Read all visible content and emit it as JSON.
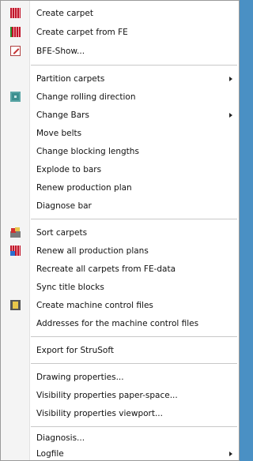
{
  "menu": {
    "items": [
      {
        "label": "Create carpet",
        "icon": "carpet-icon",
        "submenu": false
      },
      {
        "label": "Create carpet from FE",
        "icon": "carpet-fe-icon",
        "submenu": false
      },
      {
        "label": "BFE-Show...",
        "icon": "bfe-show-icon",
        "submenu": false
      },
      {
        "label": "Partition carpets",
        "icon": "",
        "submenu": true
      },
      {
        "label": "Change rolling direction",
        "icon": "rolling-direction-icon",
        "submenu": false
      },
      {
        "label": "Change Bars",
        "icon": "",
        "submenu": true
      },
      {
        "label": "Move belts",
        "icon": "",
        "submenu": false
      },
      {
        "label": "Change blocking lengths",
        "icon": "",
        "submenu": false
      },
      {
        "label": "Explode to bars",
        "icon": "",
        "submenu": false
      },
      {
        "label": "Renew production plan",
        "icon": "",
        "submenu": false
      },
      {
        "label": "Diagnose bar",
        "icon": "",
        "submenu": false
      },
      {
        "label": "Sort carpets",
        "icon": "sort-carpets-icon",
        "submenu": false
      },
      {
        "label": "Renew all production plans",
        "icon": "renew-plans-icon",
        "submenu": false
      },
      {
        "label": "Recreate all carpets from FE-data",
        "icon": "",
        "submenu": false
      },
      {
        "label": "Sync title blocks",
        "icon": "",
        "submenu": false
      },
      {
        "label": "Create machine control files",
        "icon": "machine-control-icon",
        "submenu": false
      },
      {
        "label": "Addresses for the machine control files",
        "icon": "",
        "submenu": false
      },
      {
        "label": "Export for StruSoft",
        "icon": "",
        "submenu": false
      },
      {
        "label": "Drawing properties...",
        "icon": "",
        "submenu": false
      },
      {
        "label": "Visibility properties paper-space...",
        "icon": "",
        "submenu": false
      },
      {
        "label": "Visibility properties viewport...",
        "icon": "",
        "submenu": false
      },
      {
        "label": "Diagnosis...",
        "icon": "",
        "submenu": false
      },
      {
        "label": "Logfile",
        "icon": "",
        "submenu": true
      }
    ]
  }
}
